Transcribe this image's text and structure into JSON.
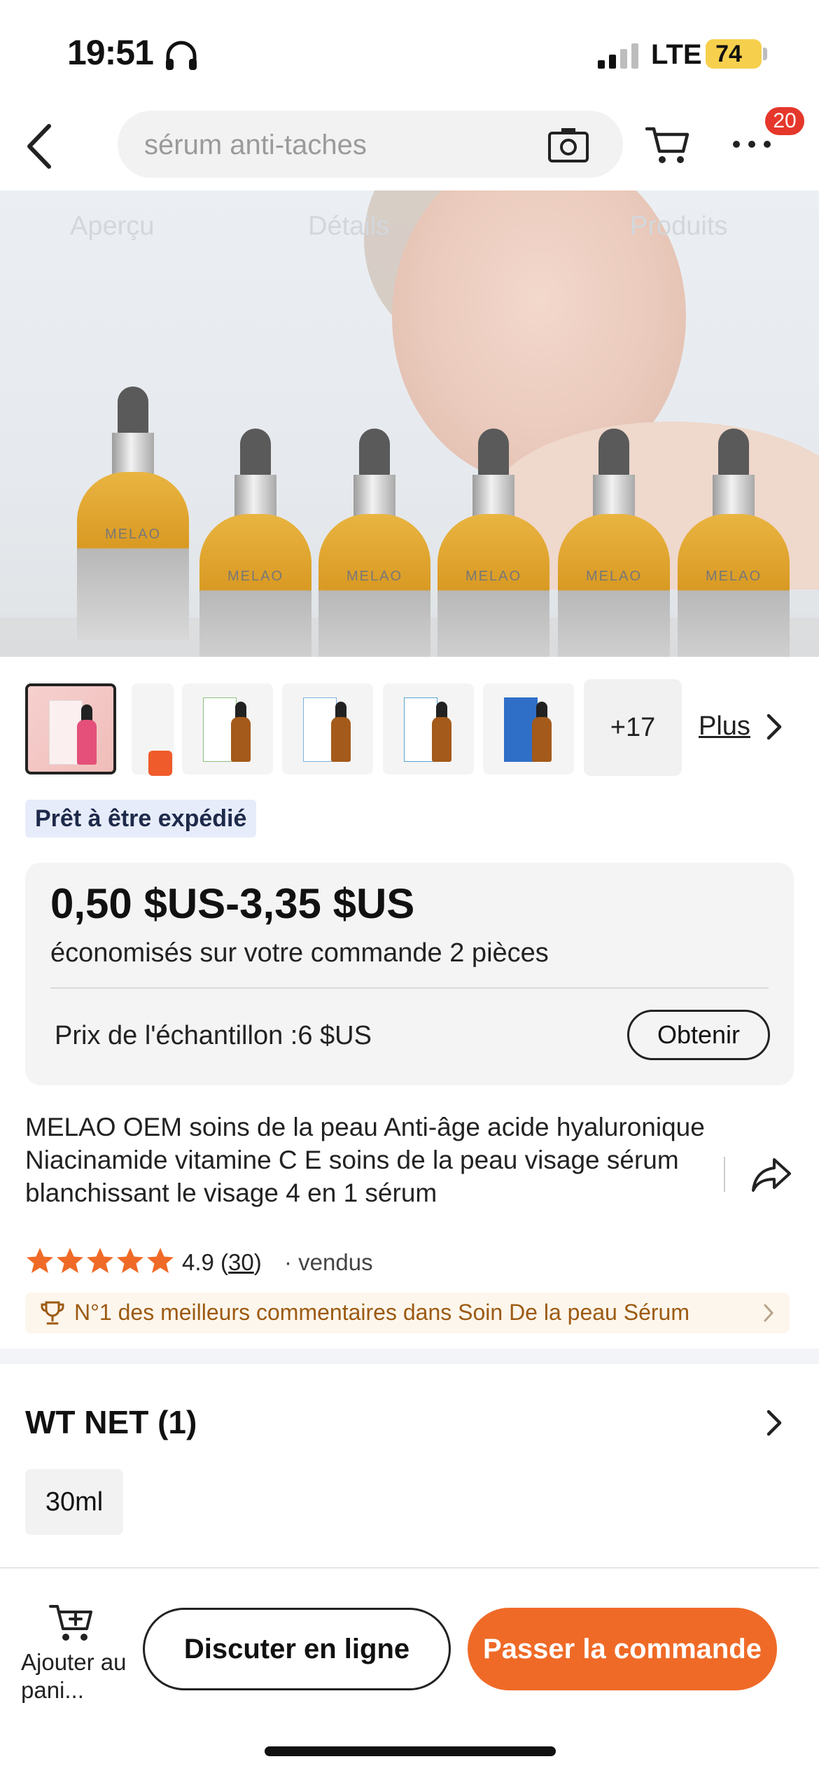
{
  "status_bar": {
    "time": "19:51",
    "network": "LTE",
    "battery": "74"
  },
  "navbar": {
    "search_placeholder": "sérum anti-taches",
    "cart_badge": "20"
  },
  "hero": {
    "brand_text": "MELAO",
    "ghost_tabs": [
      "Aperçu",
      "Détails",
      "Produits"
    ]
  },
  "gallery": {
    "more_count": "+17",
    "more_link": "Plus"
  },
  "shipping_badge": "Prêt à être expédié",
  "pricing": {
    "price_range": "0,50 $US-3,35 $US",
    "savings_note": "économisés sur votre commande 2 pièces",
    "sample_label": "Prix de l'échantillon :6 $US",
    "obtain_label": "Obtenir"
  },
  "product": {
    "title": "MELAO OEM soins de la peau Anti-âge acide hyaluronique Niacinamide vitamine C E soins de la peau visage sérum blanchissant le visage 4 en 1 sérum",
    "rating_value": "4.9",
    "rating_count": "30",
    "sold_text": "· vendus",
    "stars": 5,
    "ranking_text": "N°1 des meilleurs commentaires dans Soin De la peau Sérum"
  },
  "spec": {
    "title": "WT NET (1)",
    "option": "30ml"
  },
  "bottom_bar": {
    "add_to_cart_label": "Ajouter au pani...",
    "chat_label": "Discuter en ligne",
    "order_label": "Passer la commande"
  },
  "colors": {
    "accent": "#ef6a27",
    "badge": "#e5372b",
    "battery": "#f6d04d",
    "rank_text": "#9c5a12",
    "star": "#ef6a27"
  }
}
